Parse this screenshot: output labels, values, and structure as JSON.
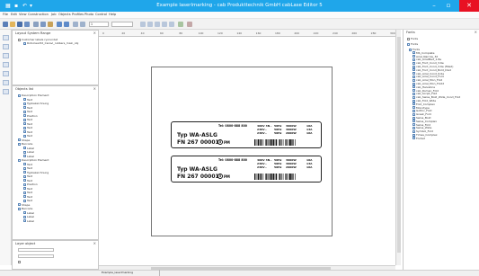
{
  "window": {
    "title": "Example laserlmarking - cab Produkttechnik GmbH cabLase Editor 5"
  },
  "menu": [
    "File",
    "Edit",
    "View",
    "Construction",
    "Job",
    "Objects",
    "Profiles",
    "Photo",
    "Control",
    "Help"
  ],
  "toolbar": {
    "zoom_value": "1",
    "layer_value": ""
  },
  "layout_panel": {
    "title": "Layout System Range",
    "root": "Customer labels ryorundet",
    "child": "Rotoclearltd_Caravi_rubbers_main_obj"
  },
  "objects_panel": {
    "title": "Objects list",
    "rows": [
      "Description Element",
      "Text",
      "Typbezeichnung",
      "Text",
      "Text",
      "Position",
      "Text",
      "Text",
      "Text",
      "Text",
      "Text",
      "Shape",
      "Barcode",
      "Label",
      "Label",
      "Label",
      "Description Element",
      "Text",
      "Text",
      "Typbezeichnung",
      "Text",
      "Text",
      "Position",
      "Text",
      "Text",
      "Text",
      "Text",
      "Shape",
      "Barcode",
      "Label",
      "Label",
      "Label"
    ]
  },
  "layer_panel": {
    "title": "Layer object"
  },
  "label": {
    "tel": "Tel: 0800-888 800",
    "type": "Typ WA-ASLG",
    "fn_prefix": "FN 267 00001",
    "fn_digit": "5",
    "fn_suffix": "PM",
    "spec_col1": [
      "400V 3N~",
      "230V~",
      "230V~"
    ],
    "spec_col2": [
      "50Hz",
      "50Hz",
      "50Hz"
    ],
    "spec_col3": [
      "3000W",
      "3000W",
      "2000W"
    ],
    "spec_col4": [
      "10A",
      "13A",
      "16A"
    ]
  },
  "ruler": {
    "ticks": [
      "0",
      "20",
      "40",
      "60",
      "80",
      "100",
      "120",
      "140",
      "160",
      "180",
      "200",
      "220",
      "240",
      "260",
      "280",
      "300"
    ]
  },
  "right_panel": {
    "title": "Fonts",
    "tab": "Fonts",
    "group": "Fonts",
    "items": [
      "Fonts",
      "MS_Complete",
      "Arial_Narrow_3d",
      "cab_ArialMed_1.8e",
      "cab_Font_Cond_3.6e",
      "cab_Font_Cond_3.6e (filled)",
      "cab_Font_Cond_Bold_Disd",
      "cab_Arial_Cond_6.6e",
      "cab_Arial_Cond_Fold",
      "cab_Arial_Mon_Fold",
      "cab_Arial_Mon_Fold2",
      "cab_Helvetica",
      "cab_Roman_Fold",
      "cab_Script_Fold",
      "cab_Swiss_Bold_Wide_Cond_Fold",
      "cab_Fold_Wide",
      "Fold_Complex",
      "Monotype",
      "Gothic_Fold",
      "Greek_Fold",
      "Swiss_Bold",
      "Swiss_Complex",
      "Swiss_Fold",
      "Swiss_Wide",
      "Symbol_Fold",
      "Times_Complex",
      "Fonts2"
    ]
  },
  "status": {
    "tab": "Example_laserlmarking"
  },
  "colors": {
    "title_bar": "#1fa6ea",
    "close_button": "#e81123"
  }
}
